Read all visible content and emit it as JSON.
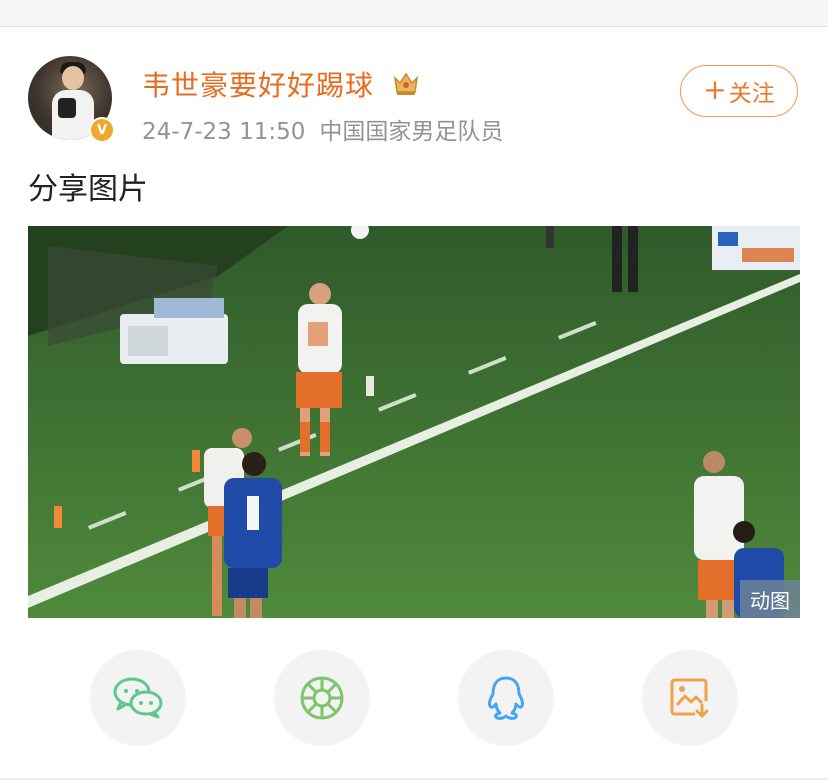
{
  "post": {
    "username": "韦世豪要好好踢球",
    "timestamp": "24-7-23 11:50",
    "verification": "中国国家男足队员",
    "follow_label": "关注",
    "follow_plus": "+",
    "text": "分享图片",
    "media_badge": "动图",
    "verified_mark": "V"
  },
  "share": {
    "items": [
      {
        "icon": "wechat-icon",
        "color": "#5cc88a"
      },
      {
        "icon": "moments-icon",
        "color": "#7cc56a"
      },
      {
        "icon": "qq-icon",
        "color": "#44a6f0"
      },
      {
        "icon": "save-image-icon",
        "color": "#f0a24a"
      }
    ]
  },
  "colors": {
    "username": "#e86b1f",
    "accent": "#f39a4b",
    "meta_text": "#939393",
    "verified_badge": "#f0a92c"
  }
}
